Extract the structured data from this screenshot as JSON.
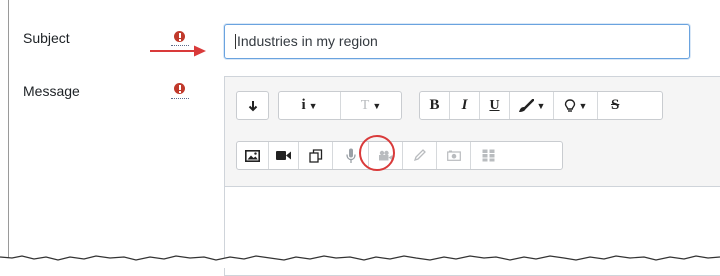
{
  "form": {
    "subject_label": "Subject",
    "message_label": "Message",
    "subject_value": "Industries in my region",
    "required_icon": "exclamation-circle-icon"
  },
  "toolbar": {
    "row1": [
      {
        "name": "toggle-toolbar",
        "icon": "arrow-down-icon"
      },
      {
        "name": "paragraph-styles",
        "icon": "info-icon"
      },
      {
        "name": "font-size",
        "icon": "text-size-icon"
      },
      {
        "name": "bold",
        "icon": "bold-icon"
      },
      {
        "name": "italic",
        "icon": "italic-icon"
      },
      {
        "name": "underline",
        "icon": "underline-icon"
      },
      {
        "name": "color",
        "icon": "paintbrush-icon"
      },
      {
        "name": "highlight",
        "icon": "lightbulb-icon"
      },
      {
        "name": "strikethrough",
        "icon": "strikethrough-icon"
      }
    ],
    "row2": [
      {
        "name": "image",
        "icon": "image-icon"
      },
      {
        "name": "video",
        "icon": "video-camera-icon"
      },
      {
        "name": "copy",
        "icon": "copy-icon"
      },
      {
        "name": "record-audio",
        "icon": "microphone-icon"
      },
      {
        "name": "record-video",
        "icon": "video-recorder-icon"
      },
      {
        "name": "draw",
        "icon": "pencil-icon"
      },
      {
        "name": "screenshot",
        "icon": "camera-icon"
      },
      {
        "name": "table",
        "icon": "grid-icon"
      }
    ],
    "labels": {
      "bold": "B",
      "italic": "I",
      "underline": "U",
      "strike": "S",
      "info": "i",
      "fontsize": "T"
    }
  },
  "annotation": {
    "arrow_color": "#d93a3a",
    "circle_color": "#d93a3a"
  }
}
